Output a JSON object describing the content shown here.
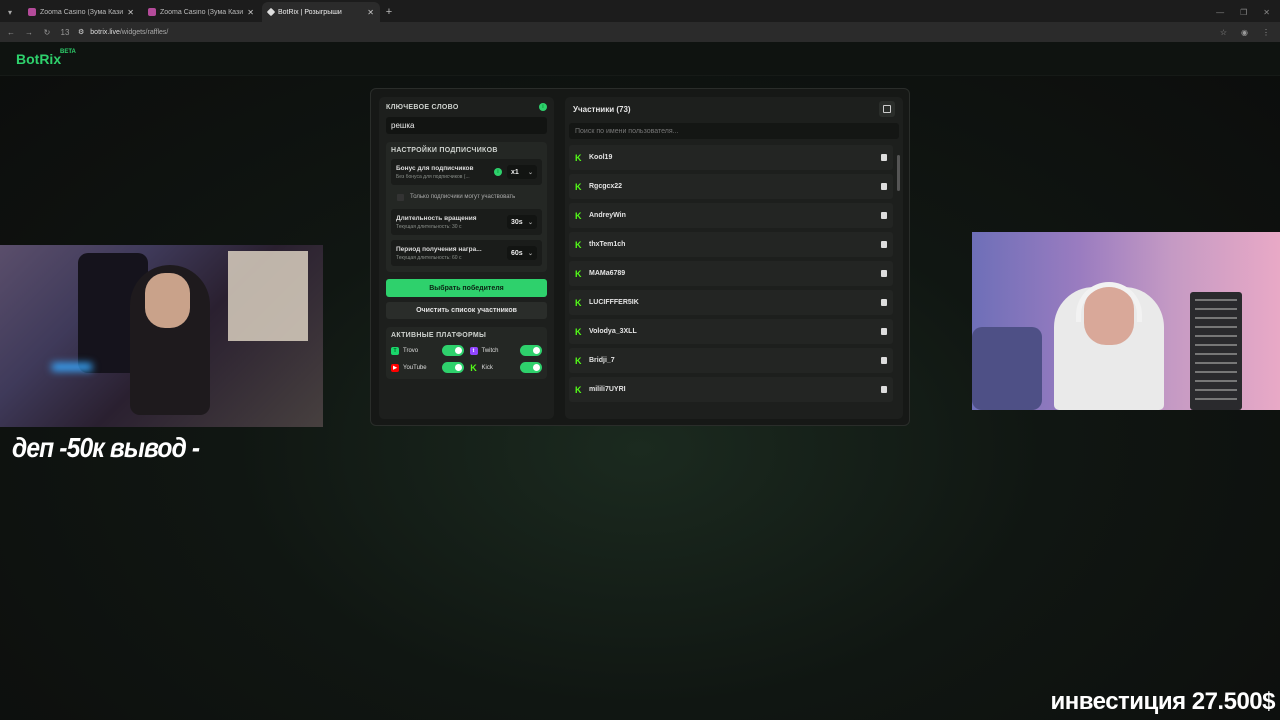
{
  "browser": {
    "tabs": [
      {
        "title": "Zooma Casino (Зума Казино) –",
        "active": false
      },
      {
        "title": "Zooma Casino (Зума Казино) –",
        "active": false
      },
      {
        "title": "BotRix | Розыгрыши",
        "active": true
      }
    ],
    "url_host": "botrix.live",
    "url_path": "/widgets/raffles/",
    "badge": "13"
  },
  "app": {
    "logo": "BotRix",
    "logo_tag": "BETA"
  },
  "raffle": {
    "keyword_label": "КЛЮЧЕВОЕ СЛОВО",
    "keyword_value": "решка",
    "sub_settings_label": "НАСТРОЙКИ ПОДПИСЧИКОВ",
    "sub_bonus_title": "Бонус для подписчиков",
    "sub_bonus_desc": "Без бонуса для подписчиков (...",
    "sub_bonus_value": "x1",
    "subs_only_label": "Только подписчики могут участвовать",
    "spin_title": "Длительность вращения",
    "spin_desc": "Текущая длительность: 30 с",
    "spin_value": "30s",
    "claim_title": "Период получения награ...",
    "claim_desc": "Текущая длительность: 60 с",
    "claim_value": "60s",
    "pick_winner": "Выбрать победителя",
    "clear_list": "Очистить список участников",
    "platforms_label": "АКТИВНЫЕ ПЛАТФОРМЫ",
    "platforms": [
      {
        "name": "Trovo",
        "color": "#19d66b",
        "on": true
      },
      {
        "name": "Twitch",
        "color": "#9146ff",
        "on": true
      },
      {
        "name": "YouTube",
        "color": "#ff0000",
        "on": true
      },
      {
        "name": "Kick",
        "color": "#53fc18",
        "on": true
      }
    ]
  },
  "participants": {
    "title": "Участники (73)",
    "search_placeholder": "Поиск по имени пользователя...",
    "list": [
      "Kool19",
      "Rgcgcx22",
      "AndreyWin",
      "thxTem1ch",
      "MAMa6789",
      "LUCIFFFER5IK",
      "Volodya_3XLL",
      "Bridji_7",
      "milili7UYRI"
    ]
  },
  "overlay": {
    "left_text": "деп -50к вывод -",
    "right_text": "инвестиция 27.500$"
  }
}
